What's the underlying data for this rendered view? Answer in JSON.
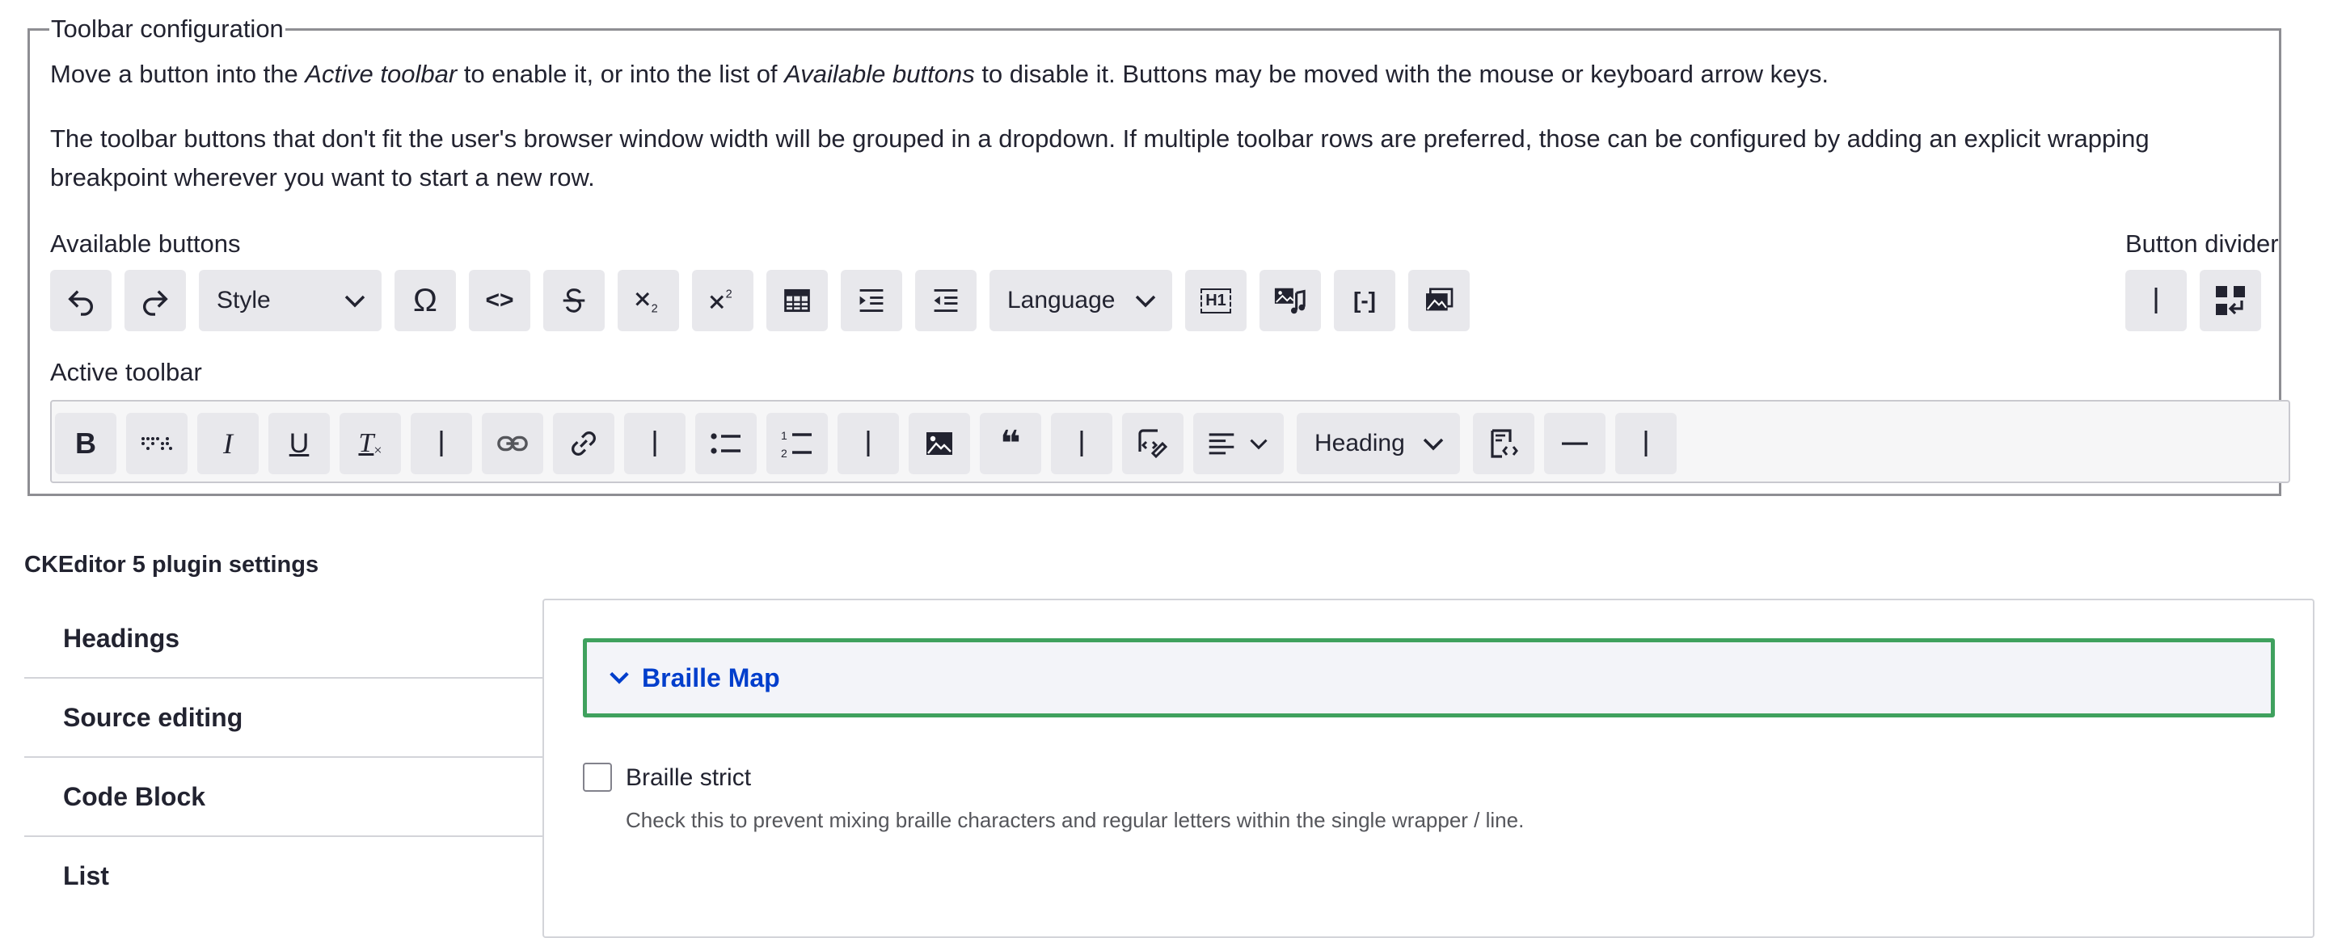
{
  "toolbar_config": {
    "legend": "Toolbar configuration",
    "help1": {
      "pre": "Move a button into the ",
      "active_em": "Active toolbar",
      "mid": " to enable it, or into the list of ",
      "available_em": "Available buttons",
      "post": " to disable it. Buttons may be moved with the mouse or keyboard arrow keys."
    },
    "help2_line1": "The toolbar buttons that don't fit the user's browser window width will be grouped in a dropdown. If multiple toolbar rows are preferred, those can be configured by adding an explicit wrapping",
    "help2_line2": "breakpoint wherever you want to start a new row.",
    "available_label": "Available buttons",
    "divider_label": "Button divider",
    "active_label": "Active toolbar",
    "available_buttons": [
      {
        "icon": "undo-icon"
      },
      {
        "icon": "redo-icon"
      },
      {
        "label": "Style",
        "type": "dropdown"
      },
      {
        "icon": "special-characters-icon",
        "glyph": "Ω"
      },
      {
        "icon": "code-icon",
        "glyph": "<>"
      },
      {
        "icon": "strikethrough-icon"
      },
      {
        "icon": "subscript-icon"
      },
      {
        "icon": "superscript-icon"
      },
      {
        "icon": "table-icon"
      },
      {
        "icon": "indent-icon"
      },
      {
        "icon": "outdent-icon"
      },
      {
        "label": "Language",
        "type": "dropdown"
      },
      {
        "icon": "heading-h1-icon",
        "glyph": "H1"
      },
      {
        "icon": "media-icon"
      },
      {
        "icon": "braille-icon",
        "glyph": "[-]"
      },
      {
        "icon": "media-library-icon"
      }
    ],
    "divider_buttons": [
      {
        "icon": "divider-icon"
      },
      {
        "icon": "wrapping-icon"
      }
    ],
    "active_buttons": [
      {
        "icon": "bold-icon",
        "glyph": "B"
      },
      {
        "icon": "braille-dots-icon"
      },
      {
        "icon": "italic-icon",
        "glyph": "I"
      },
      {
        "icon": "underline-icon",
        "glyph": "U"
      },
      {
        "icon": "remove-format-icon",
        "glyph": "T"
      },
      {
        "icon": "divider-icon"
      },
      {
        "icon": "unlink-icon"
      },
      {
        "icon": "link-icon"
      },
      {
        "icon": "divider-icon"
      },
      {
        "icon": "bulleted-list-icon"
      },
      {
        "icon": "numbered-list-icon"
      },
      {
        "icon": "divider-icon"
      },
      {
        "icon": "image-icon"
      },
      {
        "icon": "blockquote-icon",
        "glyph": "❝"
      },
      {
        "icon": "divider-icon"
      },
      {
        "icon": "source-editing-icon"
      },
      {
        "icon": "align-icon"
      },
      {
        "label": "Heading",
        "type": "dropdown"
      },
      {
        "icon": "code-block-icon"
      },
      {
        "icon": "horizontal-line-icon"
      },
      {
        "icon": "divider-icon"
      }
    ]
  },
  "plugin_settings": {
    "title": "CKEditor 5 plugin settings",
    "tabs": [
      "Headings",
      "Source editing",
      "Code Block",
      "List"
    ],
    "details_title": "Braille Map",
    "checkbox_label": "Braille strict",
    "checkbox_checked": false,
    "checkbox_description": "Check this to prevent mixing braille characters and regular letters within the single wrapper / line."
  },
  "colors": {
    "accent_border": "#3fa15e",
    "link_blue": "#003ecc",
    "button_bg": "#e8e8ec"
  }
}
